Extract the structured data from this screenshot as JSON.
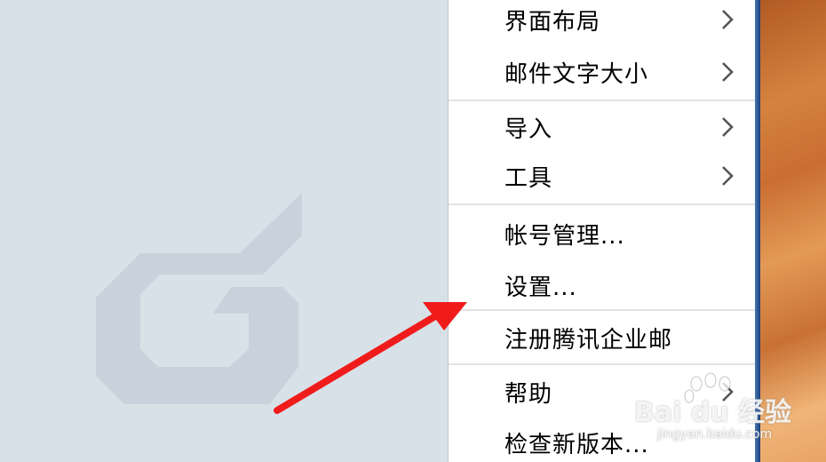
{
  "menu": {
    "items": [
      {
        "label": "界面布局",
        "has_submenu": true
      },
      {
        "label": "邮件文字大小",
        "has_submenu": true
      },
      {
        "label": "导入",
        "has_submenu": true
      },
      {
        "label": "工具",
        "has_submenu": true
      },
      {
        "label": "帐号管理...",
        "has_submenu": false
      },
      {
        "label": "设置...",
        "has_submenu": false
      },
      {
        "label": "注册腾讯企业邮",
        "has_submenu": false
      },
      {
        "label": "帮助",
        "has_submenu": true
      },
      {
        "label": "检查新版本...",
        "has_submenu": false
      }
    ]
  },
  "watermark": {
    "brand": "Bai du 经验",
    "url": "jingyan.baidu.com"
  },
  "annotation": {
    "arrow_color": "#f01c1c",
    "points_to": "设置..."
  },
  "icons": {
    "submenu": "chevron-right-icon",
    "app_logo": "foxmail-g-logo-icon"
  }
}
